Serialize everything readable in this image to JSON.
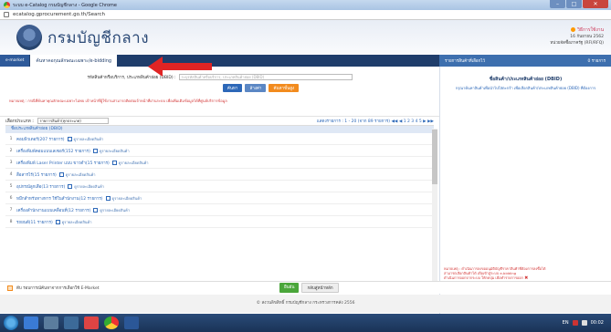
{
  "window": {
    "title": "ระบบ e-Catalog กรมบัญชีกลาง - Google Chrome",
    "minimize_label": "–",
    "maximize_label": "□",
    "close_label": "✕"
  },
  "address": {
    "url": "ecatalog.gprocurement.go.th/Search"
  },
  "header": {
    "site_name": "กรมบัญชีกลาง",
    "help_label": "วิธีการใช้งาน",
    "date_text": "16 กันยายน 2562",
    "agency_text": "หน่วยจัดซื้อภาครัฐ (RFI/RFQ)"
  },
  "nav": {
    "tab_emarket": "e-market",
    "tab_ebidding": "ค้นหาคอกุณลักษณะเฉพาะ/e-bidding",
    "cart_title": "รายการสินค้าที่เลือกไว้",
    "cart_count": "0 รายการ"
  },
  "search": {
    "label": "รหัสสินค้าหรือบริการ, ประเภทสินค้าย่อย (DBID) :",
    "placeholder": "ระบุรหัสสินค้าหรือบริการ, ประเภทสินค้าย่อย (DBID)",
    "search_btn": "ค้นหา",
    "reset_btn": "ล้างค่า",
    "advanced_btn": "ค้นหาขั้นสูง",
    "notice": "หมายเหตุ : กรณีที่ค้นหาคุณลักษณะเฉพาะไม่พบ เจ้าหน้าที่ผู้ใช้งานสามารถติดต่อเจ้าหน้าที่ผ่านระบบ เพื่อเพิ่มเติมข้อมูลได้ที่ศูนย์บริการข้อมูล"
  },
  "filter": {
    "label": "เลือกประเภท :",
    "selected": "รายการสินค้า(ทุกประเภท)",
    "pager": "แสดงรายการ : 1 - 20 (จาก 89 รายการ) ◀◀ ◀ 1 2 3 4 5 ▶ ▶▶"
  },
  "list": {
    "header": "ชื่อประเภทสินค้าย่อย (DBID)",
    "link_label": "ดูรายละเอียดสินค้า",
    "items": [
      {
        "num": "1",
        "name": "คอมพิวเตอร์(207 รายการ)"
      },
      {
        "num": "2",
        "name": "เครื่องพิมพ์คอมแบบเลเซอร์(152 รายการ)"
      },
      {
        "num": "3",
        "name": "เครื่องพิมพ์ Laser Printer แบบ ขาวดำ(15 รายการ)"
      },
      {
        "num": "4",
        "name": "สื่อสารไร้(15 รายการ)"
      },
      {
        "num": "5",
        "name": "อุปกรณ์ลูกเสือ(13 รายการ)"
      },
      {
        "num": "6",
        "name": "หมึกสำหรับทางหาร ใช้ในสำนักงาน(12 รายการ)"
      },
      {
        "num": "7",
        "name": "เครื่องสำนักงานแบบเคลื่อนที่(12 รายการ)"
      },
      {
        "num": "8",
        "name": "รถยนต์(11 รายการ)"
      }
    ]
  },
  "sidebar": {
    "heading": "ชื่อสินค้า/ประเภทสินค้าย่อย (DBID)",
    "text": "กรุณาค้นหาสินค้าเพื่อนำไปใส่ตะกร้า เพื่อเลือกสินค้า/ประเภทสินค้าย่อย (DBID) ที่ต้องการ",
    "note1": "หมายเหตุ : ดำเนินการลงขออนุมัติบัญชีราคาสินค้าที่ต้องการลงซื้อได้",
    "note2": "สามารถเลือกสินค้าได้ เพื่อเข้าสู่ระบบ e-bidding",
    "note3": "ดำเนินการออกจากระบบ ให้กดปุ่ม เพื่อทำรายการออก",
    "note_x": "✖"
  },
  "footer": {
    "cart_text": "ดีบ รอบการณ์ค้นหาจากการเลือกใช้ E-Market",
    "confirm_btn": "ยืนยัน",
    "cancel_btn": "กลับสู่หน้าหลัก",
    "copyright": "© สงวนลิขสิทธิ์ กรมบัญชีกลาง กระทรวงการคลัง 2556"
  },
  "taskbar": {
    "lang": "EN",
    "time": "00:02"
  },
  "colors": {
    "nav_dark": "#1f3d6b",
    "accent_blue": "#2d68b8",
    "orange": "#f28b1e",
    "annotation_red": "#e02424"
  }
}
